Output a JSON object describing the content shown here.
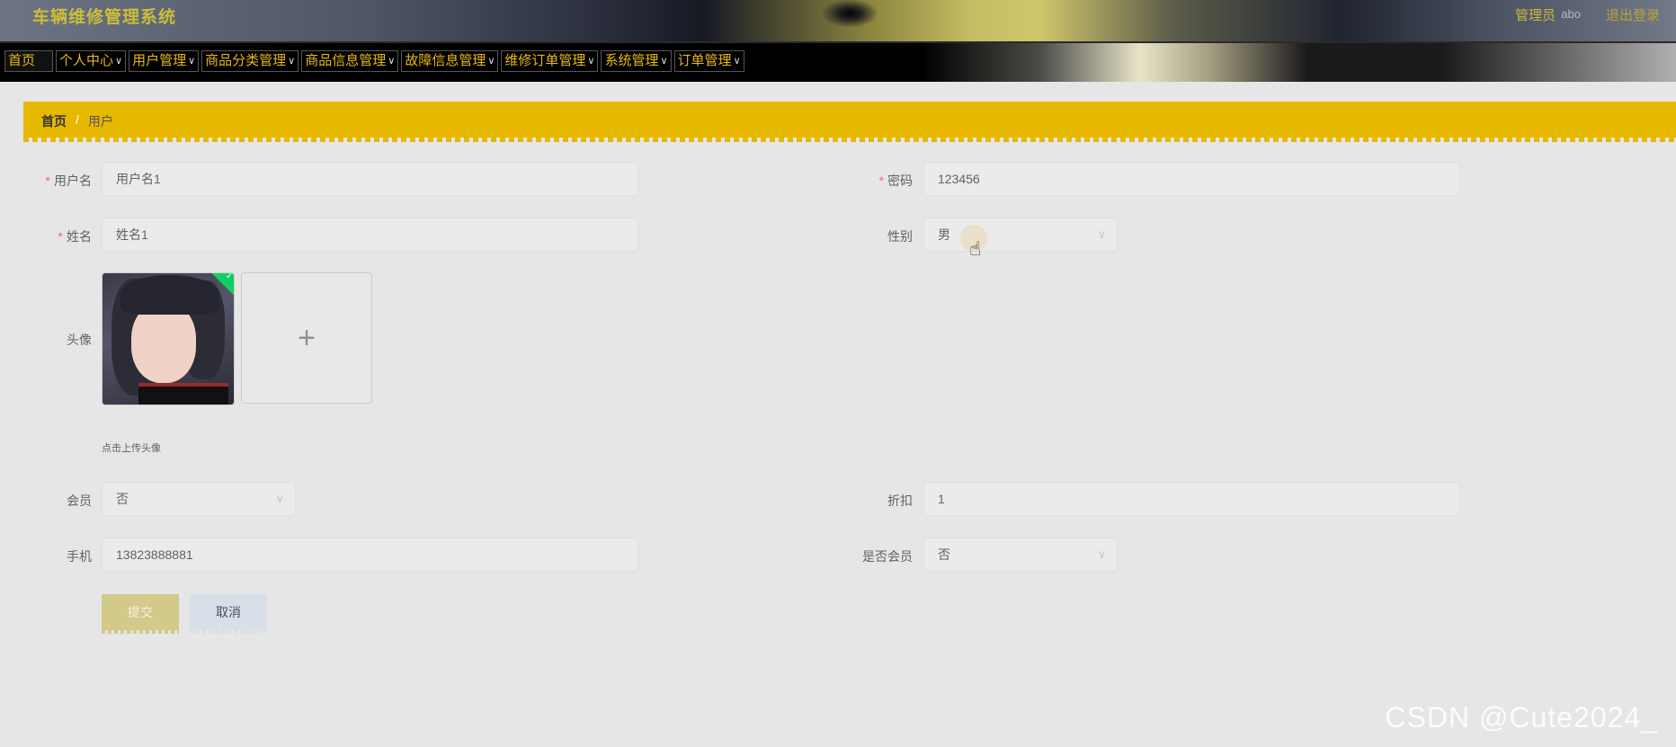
{
  "header": {
    "title": "车辆维修管理系统",
    "role": "管理员",
    "username": "abo",
    "logout": "退出登录"
  },
  "nav": [
    {
      "label": "首页",
      "dropdown": false
    },
    {
      "label": "个人中心",
      "dropdown": true
    },
    {
      "label": "用户管理",
      "dropdown": true
    },
    {
      "label": "商品分类管理",
      "dropdown": true
    },
    {
      "label": "商品信息管理",
      "dropdown": true
    },
    {
      "label": "故障信息管理",
      "dropdown": true
    },
    {
      "label": "维修订单管理",
      "dropdown": true
    },
    {
      "label": "系统管理",
      "dropdown": true
    },
    {
      "label": "订单管理",
      "dropdown": true
    }
  ],
  "breadcrumb": {
    "home": "首页",
    "separator": "/",
    "current": "用户"
  },
  "form": {
    "username": {
      "label": "用户名",
      "value": "用户名1",
      "required": true
    },
    "password": {
      "label": "密码",
      "value": "123456",
      "required": true
    },
    "name": {
      "label": "姓名",
      "value": "姓名1",
      "required": true
    },
    "gender": {
      "label": "性别",
      "value": "男"
    },
    "avatar": {
      "label": "头像",
      "upload_icon": "+",
      "hint": "点击上传头像"
    },
    "member": {
      "label": "会员",
      "value": "否"
    },
    "discount": {
      "label": "折扣",
      "value": "1"
    },
    "phone": {
      "label": "手机",
      "value": "13823888881"
    },
    "is_member": {
      "label": "是否会员",
      "value": "否"
    },
    "submit": "提交",
    "cancel": "取消"
  },
  "watermark": "CSDN @Cute2024_",
  "colors": {
    "accent": "#e6b800",
    "nav_text": "#e8b912",
    "required": "#f56c6c"
  }
}
